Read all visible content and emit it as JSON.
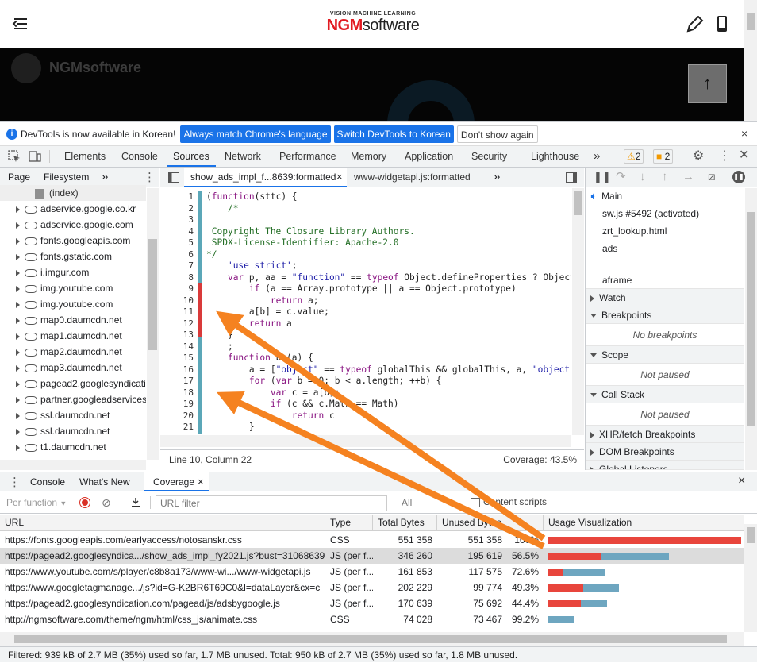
{
  "site": {
    "logo_small": "VISION MACHINE LEARNING",
    "logo_brand_red": "NGM",
    "logo_brand_dark": "software",
    "banner_brand": "NGMsoftware",
    "to_top_glyph": "↑"
  },
  "infobar": {
    "message": "DevTools is now available in Korean!",
    "btn_match": "Always match Chrome's language",
    "btn_switch": "Switch DevTools to Korean",
    "btn_dont": "Don't show again",
    "close": "×"
  },
  "main_tabs": {
    "elements": "Elements",
    "console": "Console",
    "sources": "Sources",
    "network": "Network",
    "performance": "Performance",
    "memory": "Memory",
    "application": "Application",
    "security": "Security",
    "lighthouse": "Lighthouse",
    "more": "»",
    "warnings": "2",
    "issues": "2"
  },
  "navigator": {
    "tab_page": "Page",
    "tab_filesystem": "Filesystem",
    "more": "»",
    "index": "(index)",
    "items": [
      "adservice.google.co.kr",
      "adservice.google.com",
      "fonts.googleapis.com",
      "fonts.gstatic.com",
      "i.imgur.com",
      "img.youtube.com",
      "img.youtube.com",
      "map0.daumcdn.net",
      "map1.daumcdn.net",
      "map2.daumcdn.net",
      "map3.daumcdn.net",
      "pagead2.googlesyndicati",
      "partner.googleadservices",
      "ssl.daumcdn.net",
      "ssl.daumcdn.net",
      "t1.daumcdn.net"
    ]
  },
  "editor": {
    "tab1": "show_ads_impl_f...8639:formatted",
    "tab1_close": "×",
    "tab2": "www-widgetapi.js:formatted",
    "more": "»",
    "line_numbers": [
      "1",
      "2",
      "3",
      "4",
      "5",
      "6",
      "7",
      "8",
      "9",
      "10",
      "11",
      "12",
      "13",
      "14",
      "15",
      "16",
      "17",
      "18",
      "19",
      "20",
      "21"
    ],
    "status_position": "Line 10, Column 22",
    "status_coverage": "Coverage: 43.5%"
  },
  "sidebar": {
    "threads": [
      "Main",
      "sw.js #5492 (activated)",
      "zrt_lookup.html",
      "ads",
      "",
      "aframe"
    ],
    "watch": "Watch",
    "breakpoints": "Breakpoints",
    "no_breakpoints": "No breakpoints",
    "scope": "Scope",
    "not_paused_1": "Not paused",
    "call_stack": "Call Stack",
    "not_paused_2": "Not paused",
    "xhr": "XHR/fetch Breakpoints",
    "dom": "DOM Breakpoints",
    "global": "Global Listeners"
  },
  "drawer": {
    "console": "Console",
    "whats_new": "What's New",
    "coverage": "Coverage",
    "coverage_close": "×",
    "close": "×"
  },
  "coverage_toolbar": {
    "per_function": "Per function",
    "url_filter_placeholder": "URL filter",
    "all": "All",
    "content_scripts": "Content scripts"
  },
  "coverage_table": {
    "headers": {
      "url": "URL",
      "type": "Type",
      "total": "Total Bytes",
      "unused": "Unused Bytes",
      "viz": "Usage Visualization"
    },
    "rows": [
      {
        "url": "https://fonts.googleapis.com/earlyaccess/notosanskr.css",
        "type": "CSS",
        "total": "551 358",
        "unused": "551 358",
        "pct": "100%",
        "used_frac": 0.0,
        "size_frac": 1.0
      },
      {
        "url": "https://pagead2.googlesyndica.../show_ads_impl_fy2021.js?bust=31068639",
        "type": "JS (per f...",
        "total": "346 260",
        "unused": "195 619",
        "pct": "56.5%",
        "used_frac": 0.435,
        "size_frac": 0.628
      },
      {
        "url": "https://www.youtube.com/s/player/c8b8a173/www-wi.../www-widgetapi.js",
        "type": "JS (per f...",
        "total": "161 853",
        "unused": "117 575",
        "pct": "72.6%",
        "used_frac": 0.274,
        "size_frac": 0.294
      },
      {
        "url": "https://www.googletagmanage.../js?id=G-K2BR6T69C0&l=dataLayer&cx=c",
        "type": "JS (per f...",
        "total": "202 229",
        "unused": "99 774",
        "pct": "49.3%",
        "used_frac": 0.507,
        "size_frac": 0.367
      },
      {
        "url": "https://pagead2.googlesyndication.com/pagead/js/adsbygoogle.js",
        "type": "JS (per f...",
        "total": "170 639",
        "unused": "75 692",
        "pct": "44.4%",
        "used_frac": 0.556,
        "size_frac": 0.309
      },
      {
        "url": "http://ngmsoftware.com/theme/ngm/html/css_js/animate.css",
        "type": "CSS",
        "total": "74 028",
        "unused": "73 467",
        "pct": "99.2%",
        "used_frac": 0.008,
        "size_frac": 0.134
      }
    ]
  },
  "footer": {
    "summary": "Filtered: 939 kB of 2.7 MB (35%) used so far, 1.7 MB unused. Total: 950 kB of 2.7 MB (35%) used so far, 1.8 MB unused."
  },
  "colors": {
    "accent": "#1a73e8",
    "used_bar": "#e8453c",
    "unused_bar": "#6ea6c0",
    "annotation_arrow": "#f58220",
    "coverage_used_marker": "#5ba7b8",
    "coverage_unused_marker": "#d93a3a"
  }
}
